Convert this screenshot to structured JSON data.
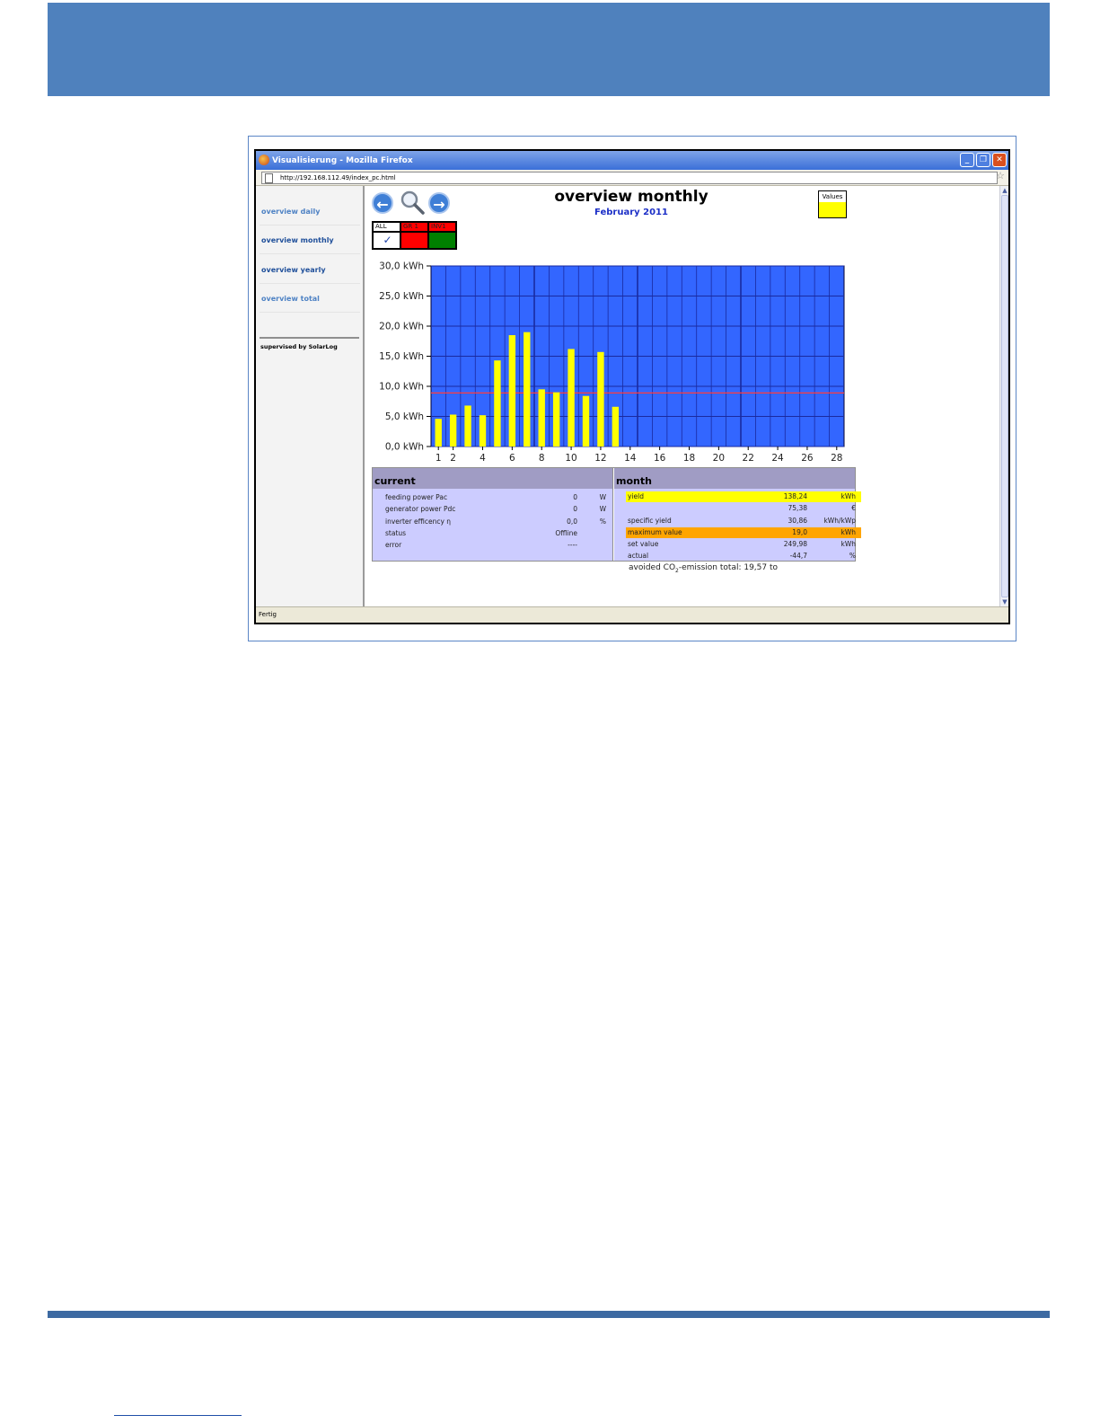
{
  "window": {
    "title": "Visualisierung - Mozilla Firefox",
    "url": "http://192.168.112.49/index_pc.html",
    "status": "Fertig"
  },
  "sidebar": {
    "items": [
      {
        "label": "overview daily"
      },
      {
        "label": "overview monthly"
      },
      {
        "label": "overview yearly"
      },
      {
        "label": "overview total"
      }
    ],
    "supervised": "supervised by SolarLog"
  },
  "selector": {
    "all": "ALL",
    "group1": "GR 1",
    "inv1": "INV1"
  },
  "legend": {
    "values_label": "Values"
  },
  "chart_data": {
    "type": "bar",
    "title": "overview monthly",
    "subtitle": "February 2011",
    "x": [
      1,
      2,
      3,
      4,
      5,
      6,
      7,
      8,
      9,
      10,
      11,
      12,
      13,
      14,
      15,
      16,
      17,
      18,
      19,
      20,
      21,
      22,
      23,
      24,
      25,
      26,
      27,
      28
    ],
    "x_tick_labels": [
      "1",
      "2",
      "4",
      "6",
      "8",
      "10",
      "12",
      "14",
      "16",
      "18",
      "20",
      "22",
      "24",
      "26",
      "28"
    ],
    "x_tick_values": [
      1,
      2,
      4,
      6,
      8,
      10,
      12,
      14,
      16,
      18,
      20,
      22,
      24,
      26,
      28
    ],
    "y_tick_labels": [
      "0,0 kWh",
      "5,0 kWh",
      "10,0 kWh",
      "15,0 kWh",
      "20,0 kWh",
      "25,0 kWh",
      "30,0 kWh"
    ],
    "y_tick_values": [
      0,
      5,
      10,
      15,
      20,
      25,
      30
    ],
    "ylim": [
      0,
      30
    ],
    "series": [
      {
        "name": "Values",
        "values": [
          4.6,
          5.3,
          6.8,
          5.2,
          14.3,
          18.5,
          19.0,
          9.5,
          9.0,
          16.2,
          8.4,
          15.7,
          6.6
        ]
      }
    ],
    "reference_line": 8.9,
    "colors": {
      "background": "#3366ff",
      "bar": "#ffff00",
      "grid": "#1a2aa0",
      "reference": "#ff3b3b"
    },
    "grid": true
  },
  "current": {
    "title": "current",
    "rows": [
      {
        "label": "feeding power Pac",
        "value": "0",
        "unit": "W"
      },
      {
        "label": "generator power Pdc",
        "value": "0",
        "unit": "W"
      },
      {
        "label": "inverter efficency η",
        "value": "0,0",
        "unit": "%"
      },
      {
        "label": "status",
        "value": "Offline",
        "unit": ""
      },
      {
        "label": "error",
        "value": "----",
        "unit": ""
      }
    ]
  },
  "month": {
    "title": "month",
    "rows": [
      {
        "label": "yield",
        "value": "138,24",
        "unit": "kWh"
      },
      {
        "label": "",
        "value": "75,38",
        "unit": "€"
      },
      {
        "label": "specific yield",
        "value": "30,86",
        "unit": "kWh/kWp"
      },
      {
        "label": "maximum value",
        "value": "19,0",
        "unit": "kWh"
      },
      {
        "label": "set value",
        "value": "249,98",
        "unit": "kWh"
      },
      {
        "label": "actual",
        "value": "-44,7",
        "unit": "%"
      }
    ]
  },
  "co2": {
    "prefix": "avoided CO",
    "sub": "2",
    "suffix": "-emission total: 19,57 to"
  }
}
